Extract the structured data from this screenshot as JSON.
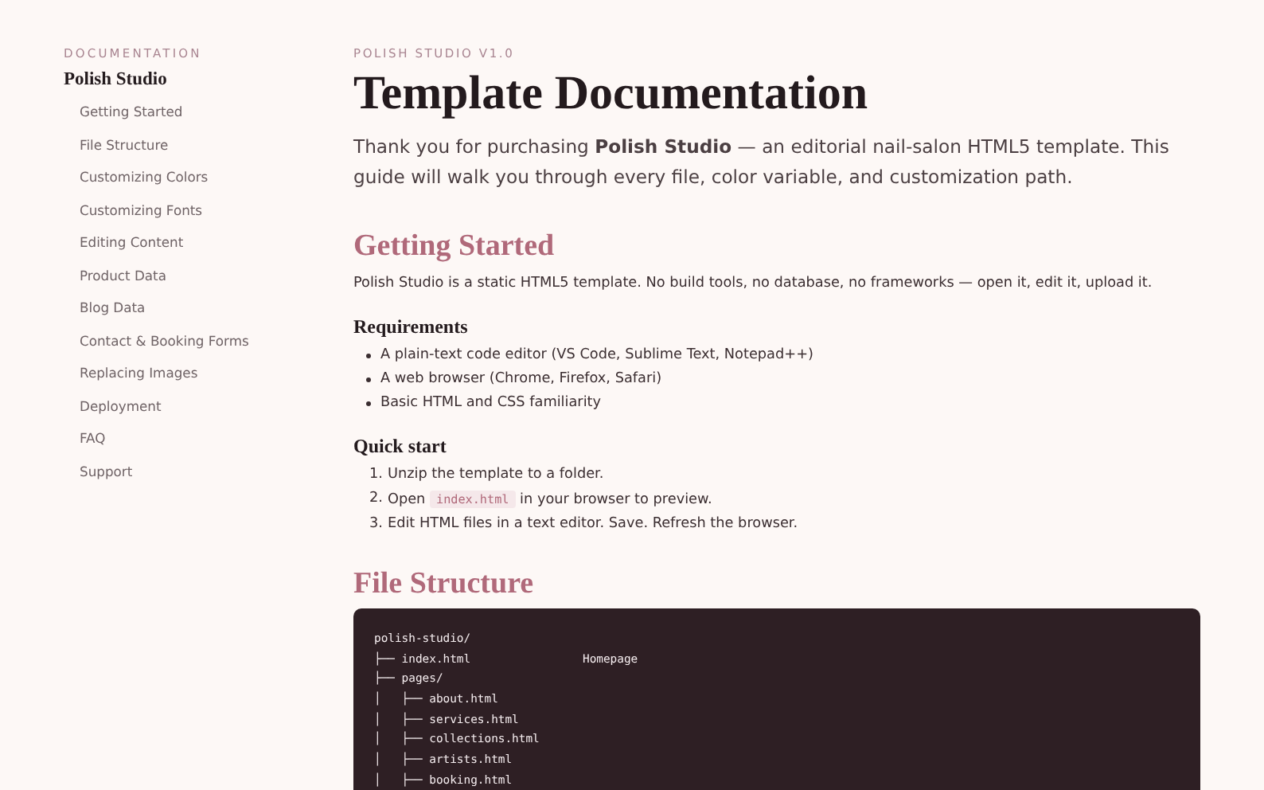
{
  "sidebar": {
    "label": "DOCUMENTATION",
    "title": "Polish Studio",
    "items": [
      {
        "label": "Getting Started",
        "selected": false
      },
      {
        "label": "File Structure",
        "selected": false
      },
      {
        "label": "Customizing Colors",
        "selected": false
      },
      {
        "label": "Customizing Fonts",
        "selected": false
      },
      {
        "label": "Editing Content",
        "selected": false
      },
      {
        "label": "Product Data",
        "selected": false
      },
      {
        "label": "Blog Data",
        "selected": false
      },
      {
        "label": "Contact & Booking Forms",
        "selected": false
      },
      {
        "label": "Replacing Images",
        "selected": false
      },
      {
        "label": "Deployment",
        "selected": false
      },
      {
        "label": "FAQ",
        "selected": false
      },
      {
        "label": "Support",
        "selected": false
      }
    ]
  },
  "header": {
    "eyebrow": "POLISH STUDIO V1.0",
    "title": "Template Documentation",
    "intro": "Thank you for purchasing **Polish Studio** — an editorial nail-salon HTML5 template. This guide will walk you through every file, color variable, and customization path."
  },
  "getting_started": {
    "heading": "Getting Started",
    "text": "Polish Studio is a static HTML5 template. No build tools, no database, no frameworks — open it, edit it, upload it.",
    "requirements": {
      "heading": "Requirements",
      "items": [
        "A plain-text code editor (VS Code, Sublime Text, Notepad++)",
        "A web browser (Chrome, Firefox, Safari)",
        "Basic HTML and CSS familiarity"
      ]
    },
    "quick_start": {
      "heading": "Quick start",
      "items": [
        {
          "number": "1.",
          "parts": [
            {
              "kind": "text",
              "text": "Unzip the template to a folder."
            }
          ]
        },
        {
          "number": "2.",
          "parts": [
            {
              "kind": "text",
              "text": "Open "
            },
            {
              "kind": "code",
              "text": "index.html"
            },
            {
              "kind": "text",
              "text": " in your browser to preview."
            }
          ]
        },
        {
          "number": "3.",
          "parts": [
            {
              "kind": "text",
              "text": "Edit HTML files in a text editor. Save. Refresh the browser."
            }
          ]
        }
      ]
    }
  },
  "file_structure": {
    "heading": "File Structure",
    "lines": [
      {
        "text": "polish-studio/"
      },
      {
        "text": "├── index.html",
        "comment": "Homepage"
      },
      {
        "text": "├── pages/"
      },
      {
        "text": "│   ├── about.html"
      },
      {
        "text": "│   ├── services.html"
      },
      {
        "text": "│   ├── collections.html"
      },
      {
        "text": "│   ├── artists.html"
      },
      {
        "text": "│   ├── booking.html"
      }
    ]
  }
}
